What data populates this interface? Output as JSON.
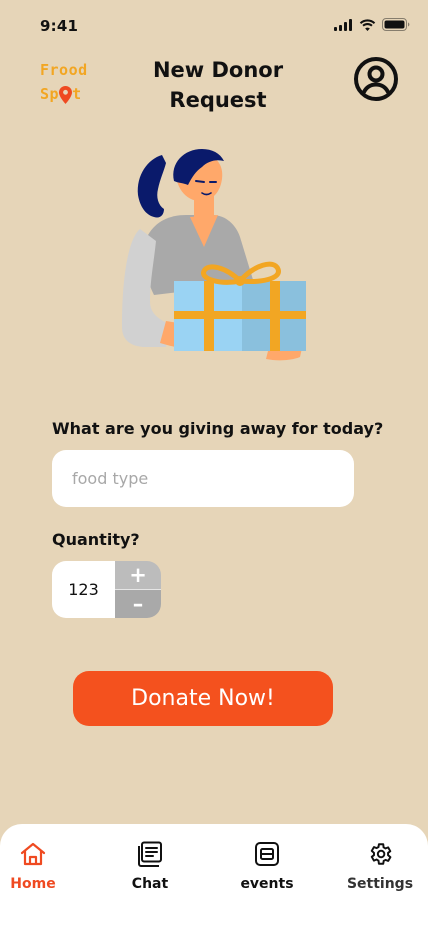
{
  "status_bar": {
    "time": "9:41"
  },
  "logo": {
    "line1": "Frood",
    "line2_prefix": "Sp",
    "line2_suffix": "t"
  },
  "header": {
    "title_line1": "New Donor",
    "title_line2": "Request"
  },
  "form": {
    "food_question": "What are you giving away for today?",
    "food_placeholder": "food type",
    "food_value": "",
    "quantity_label": "Quantity?",
    "quantity_value": "123",
    "plus_label": "+",
    "minus_label": "–"
  },
  "donate_button": {
    "label": "Donate Now!"
  },
  "nav": {
    "items": [
      {
        "label": "Home",
        "icon": "home-icon",
        "active": true
      },
      {
        "label": "Chat",
        "icon": "chat-icon",
        "active": false
      },
      {
        "label": "events",
        "icon": "events-icon",
        "active": false
      },
      {
        "label": "Settings",
        "icon": "gear-icon",
        "active": false
      }
    ]
  },
  "colors": {
    "background": "#e6d5b8",
    "accent": "#f4511e",
    "logo": "#f2a623",
    "input_bg": "#ffffff",
    "stepper_grey": "#a9a9a9",
    "nav_active": "#ef4a21"
  }
}
